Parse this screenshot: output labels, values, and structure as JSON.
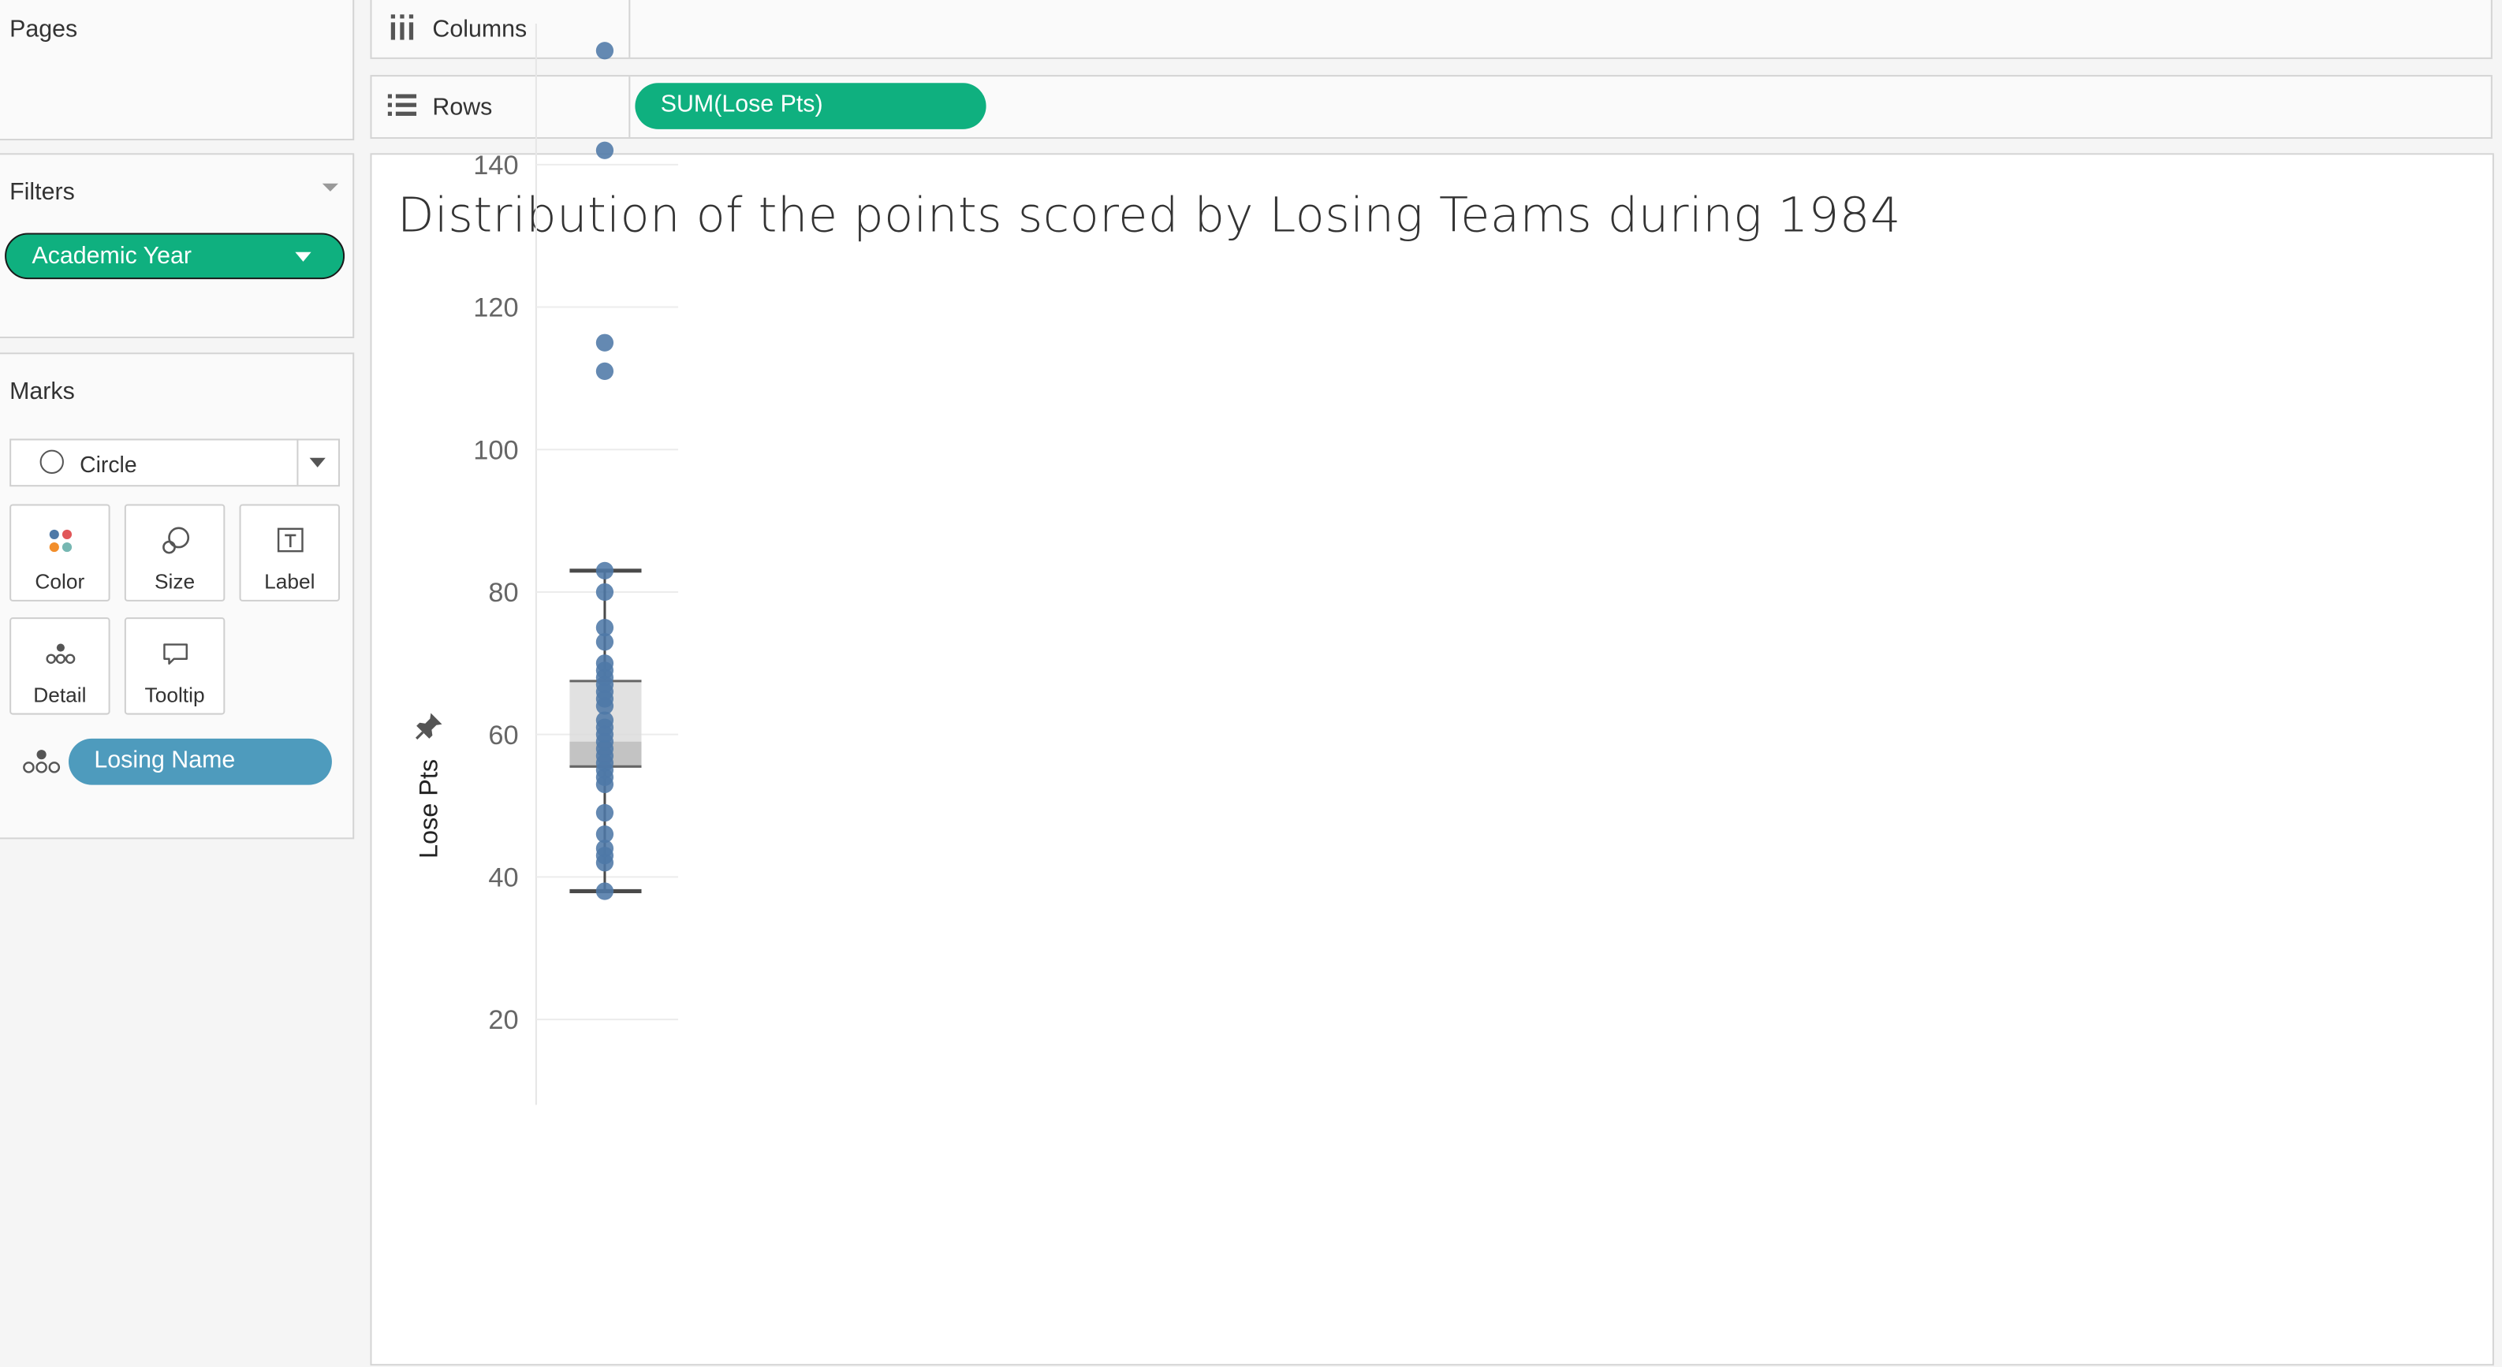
{
  "left_panel": {
    "pages_title": "Pages",
    "filters_title": "Filters",
    "filter_pill": "Academic Year",
    "marks_title": "Marks",
    "mark_type": "Circle",
    "mark_buttons": {
      "color": "Color",
      "size": "Size",
      "label": "Label",
      "detail": "Detail",
      "tooltip": "Tooltip"
    },
    "detail_pill": "Losing Name"
  },
  "shelves": {
    "columns_label": "Columns",
    "rows_label": "Rows",
    "rows_pill": "SUM(Lose Pts)"
  },
  "colors": {
    "green_pill": "#0fb07f",
    "blue_pill": "#4e9bbd",
    "point": "#4e79a7",
    "whisker": "#4a4a4a"
  },
  "chart_data": {
    "type": "scatter",
    "title": "Distribution of the points scored by Losing Teams during 1984",
    "ylabel": "Lose Pts",
    "ylim": [
      8,
      158
    ],
    "yticks": [
      20,
      40,
      60,
      80,
      100,
      120,
      140
    ],
    "values": [
      156,
      142,
      115,
      111,
      83,
      80,
      75,
      73,
      70,
      69,
      68,
      67,
      66,
      65,
      64,
      62,
      61,
      60,
      59,
      58,
      57,
      56,
      55,
      54,
      53,
      49,
      46,
      44,
      43,
      42,
      38
    ],
    "boxplot": {
      "lower_whisker": 38,
      "q1": 55.5,
      "median": 59,
      "q3": 67.5,
      "upper_whisker": 83
    }
  }
}
